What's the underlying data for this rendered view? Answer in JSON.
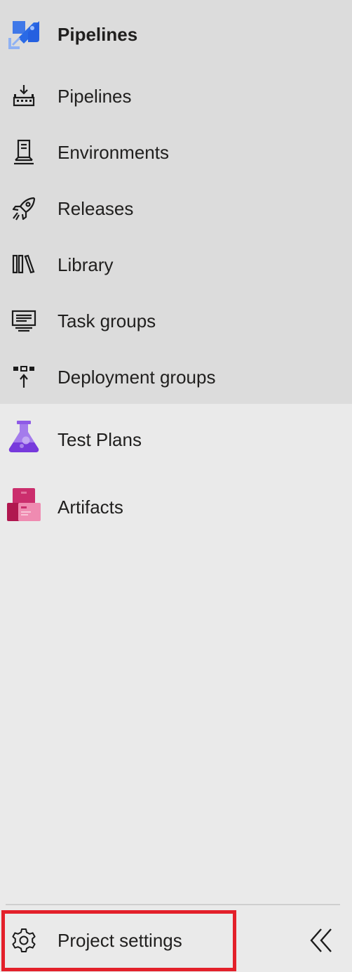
{
  "pipelines_hub": {
    "title": "Pipelines",
    "items": [
      {
        "label": "Pipelines",
        "icon": "pipelines-factory-icon"
      },
      {
        "label": "Environments",
        "icon": "environments-server-icon"
      },
      {
        "label": "Releases",
        "icon": "rocket-icon"
      },
      {
        "label": "Library",
        "icon": "library-books-icon"
      },
      {
        "label": "Task groups",
        "icon": "task-groups-icon"
      },
      {
        "label": "Deployment groups",
        "icon": "deployment-groups-icon"
      }
    ]
  },
  "other_hubs": [
    {
      "label": "Test Plans",
      "icon": "test-plans-flask-icon"
    },
    {
      "label": "Artifacts",
      "icon": "artifacts-boxes-icon"
    }
  ],
  "footer": {
    "settings_label": "Project settings",
    "settings_icon": "gear-icon",
    "collapse_icon": "double-chevron-left-icon"
  },
  "colors": {
    "expanded_group_bg": "#dcdcdc",
    "sidebar_bg": "#eaeaea",
    "pipelines_blue": "#2560e0",
    "test_plans_purple": "#773adc",
    "artifacts_pink": "#cb2e6d",
    "highlight_red": "#e3202a"
  }
}
